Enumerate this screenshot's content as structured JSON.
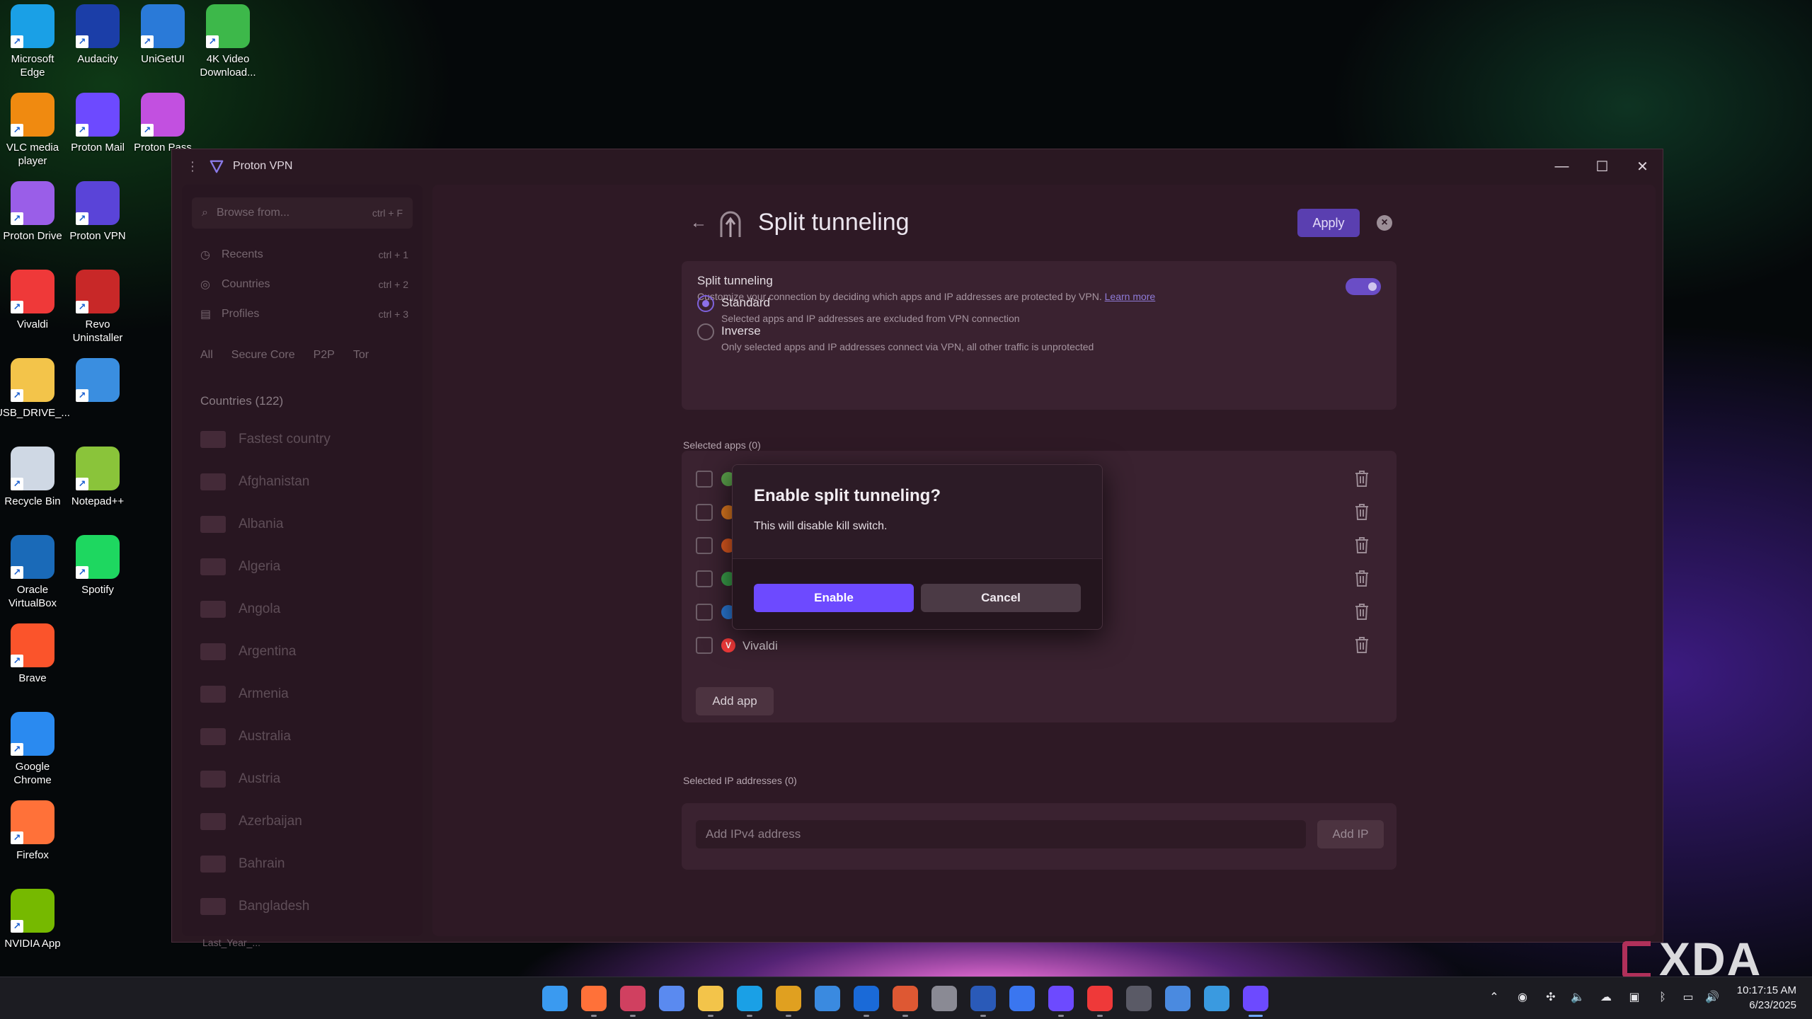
{
  "desktop": {
    "icons": [
      {
        "label": "Microsoft\nEdge",
        "icon": "edge-icon",
        "color": "#1aa0e6"
      },
      {
        "label": "Audacity",
        "icon": "audacity-icon",
        "color": "#1b3ea8"
      },
      {
        "label": "UniGetUI",
        "icon": "unigetui-icon",
        "color": "#2a7ad8"
      },
      {
        "label": "4K Video\nDownload...",
        "icon": "4k-video-downloader-icon",
        "color": "#3db84a"
      },
      {
        "label": "VLC media\nplayer",
        "icon": "vlc-icon",
        "color": "#f08a10"
      },
      {
        "label": "Proton Mail",
        "icon": "proton-mail-icon",
        "color": "#6d4aff"
      },
      {
        "label": "Proton Pass",
        "icon": "proton-pass-icon",
        "color": "#c250e0"
      },
      {
        "label": "Proton Drive",
        "icon": "proton-drive-icon",
        "color": "#9a5ee8"
      },
      {
        "label": "Proton VPN",
        "icon": "proton-vpn-icon",
        "color": "#5a44d8"
      },
      {
        "label": "Vivaldi",
        "icon": "vivaldi-icon",
        "color": "#ef3939"
      },
      {
        "label": "Revo\nUninstaller",
        "icon": "revo-uninstaller-icon",
        "color": "#c82828"
      },
      {
        "label": "USB_DRIVE_...",
        "icon": "folder-icon",
        "color": "#f3c44a"
      },
      {
        "label": "",
        "icon": "control-panel-icon",
        "color": "#3a8ee0"
      },
      {
        "label": "Recycle Bin",
        "icon": "recycle-bin-icon",
        "color": "#cfd8e4"
      },
      {
        "label": "Notepad++",
        "icon": "notepad-plus-plus-icon",
        "color": "#8ac43a"
      },
      {
        "label": "Oracle\nVirtualBox",
        "icon": "virtualbox-icon",
        "color": "#1a6ab8"
      },
      {
        "label": "Spotify",
        "icon": "spotify-icon",
        "color": "#1ed760"
      },
      {
        "label": "Brave",
        "icon": "brave-icon",
        "color": "#fb542b"
      },
      {
        "label": "Google\nChrome",
        "icon": "chrome-icon",
        "color": "#2a8af0"
      },
      {
        "label": "Firefox",
        "icon": "firefox-icon",
        "color": "#ff7139"
      },
      {
        "label": "NVIDIA App",
        "icon": "nvidia-icon",
        "color": "#76b900"
      }
    ]
  },
  "window": {
    "title": "Proton VPN",
    "sidebar": {
      "search_placeholder": "Browse from...",
      "search_shortcut": "ctrl + F",
      "nav": [
        {
          "label": "Recents",
          "shortcut": "ctrl + 1"
        },
        {
          "label": "Countries",
          "shortcut": "ctrl + 2"
        },
        {
          "label": "Profiles",
          "shortcut": "ctrl + 3"
        }
      ],
      "filters": [
        "All",
        "Secure Core",
        "P2P",
        "Tor"
      ],
      "countries_header": "Countries (122)",
      "countries": [
        "Fastest country",
        "Afghanistan",
        "Albania",
        "Algeria",
        "Angola",
        "Argentina",
        "Armenia",
        "Australia",
        "Austria",
        "Azerbaijan",
        "Bahrain",
        "Bangladesh"
      ]
    },
    "page": {
      "title": "Split tunneling",
      "apply_label": "Apply",
      "split": {
        "title": "Split tunneling",
        "description": "Customize your connection by deciding which apps and IP addresses are protected by VPN.",
        "learn_more": "Learn more",
        "enabled": true
      },
      "modes": [
        {
          "label": "Standard",
          "description": "Selected apps and IP addresses are excluded from VPN connection",
          "checked": true
        },
        {
          "label": "Inverse",
          "description": "Only selected apps and IP addresses connect via VPN, all other traffic is unprotected",
          "checked": false
        }
      ],
      "selected_apps_label": "Selected apps (0)",
      "apps": [
        {
          "name": "",
          "icon_color": "#5aa04a"
        },
        {
          "name": "",
          "icon_color": "#e07a20"
        },
        {
          "name": "",
          "icon_color": "#e05a20"
        },
        {
          "name": "",
          "icon_color": "#3aa04a"
        },
        {
          "name": "",
          "icon_color": "#2a7ad8"
        },
        {
          "name": "Vivaldi",
          "icon_color": "#ef3939"
        }
      ],
      "add_app_label": "Add app",
      "selected_ip_label": "Selected IP addresses (0)",
      "ip_placeholder": "Add IPv4 address",
      "add_ip_label": "Add IP"
    },
    "dialog": {
      "title": "Enable split tunneling?",
      "message": "This will disable kill switch.",
      "enable_label": "Enable",
      "cancel_label": "Cancel"
    },
    "obscured_text": "Last_Year_..."
  },
  "taskbar": {
    "apps": [
      {
        "icon": "start-icon",
        "color": "#3a9af0"
      },
      {
        "icon": "firefox-icon",
        "color": "#ff7139"
      },
      {
        "icon": "davinci-resolve-icon",
        "color": "#d04060"
      },
      {
        "icon": "copilot-icon",
        "color": "#5a8af0"
      },
      {
        "icon": "file-explorer-icon",
        "color": "#f3c44a"
      },
      {
        "icon": "edge-icon",
        "color": "#1aa0e6"
      },
      {
        "icon": "slack-icon",
        "color": "#e0a020"
      },
      {
        "icon": "microsoft-store-icon",
        "color": "#3a8ae0"
      },
      {
        "icon": "outlook-icon",
        "color": "#1a6ad8"
      },
      {
        "icon": "duckduckgo-icon",
        "color": "#de5833"
      },
      {
        "icon": "settings-icon",
        "color": "#8a8a94"
      },
      {
        "icon": "word-icon",
        "color": "#2a5ab8"
      },
      {
        "icon": "signal-icon",
        "color": "#3a76f0"
      },
      {
        "icon": "proton-mail-icon",
        "color": "#6d4aff"
      },
      {
        "icon": "vivaldi-icon",
        "color": "#ef3939"
      },
      {
        "icon": "calculator-icon",
        "color": "#5a5a66"
      },
      {
        "icon": "notepad-icon",
        "color": "#4a8ae0"
      },
      {
        "icon": "snipping-tool-icon",
        "color": "#3a9ae0"
      },
      {
        "icon": "proton-vpn-icon",
        "color": "#6d4aff"
      }
    ],
    "clock_time": "10:17:15 AM",
    "clock_date": "6/23/2025"
  },
  "watermark": "XDA"
}
